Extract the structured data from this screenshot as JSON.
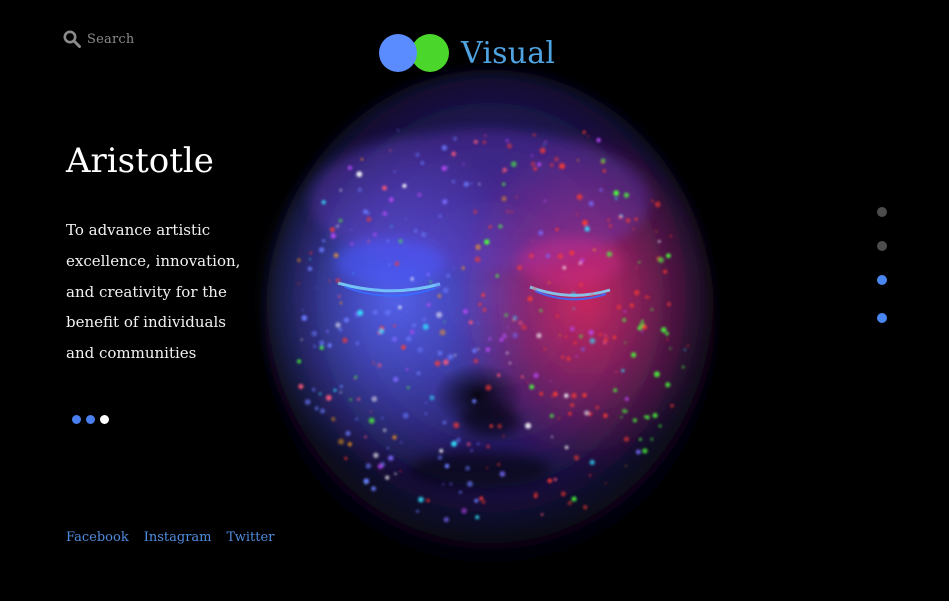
{
  "search": {
    "placeholder": "Search",
    "icon": "search-icon"
  },
  "brand": {
    "name": "Visual",
    "colors": {
      "circle_left": "#5b8cff",
      "circle_right": "#4bd62c",
      "text": "#4fa3e0"
    }
  },
  "hero": {
    "title": "Aristotle",
    "tagline": "To advance artistic excellence, innovation, and creativity for the benefit of individuals and communities"
  },
  "slider": {
    "active_index": 2,
    "dots": [
      "#4a7ff0",
      "#4a7ff0",
      "#ffffff"
    ]
  },
  "social": {
    "links": [
      "Facebook",
      "Instagram",
      "Twitter"
    ],
    "color": "#4f8de0"
  },
  "pager": {
    "dots": [
      "#4d4d4d",
      "#4d4d4d",
      "#4a86ef",
      "#4a86ef"
    ]
  },
  "colors": {
    "background": "#000000",
    "text": "#ffffff",
    "muted": "#8a8a8a"
  }
}
